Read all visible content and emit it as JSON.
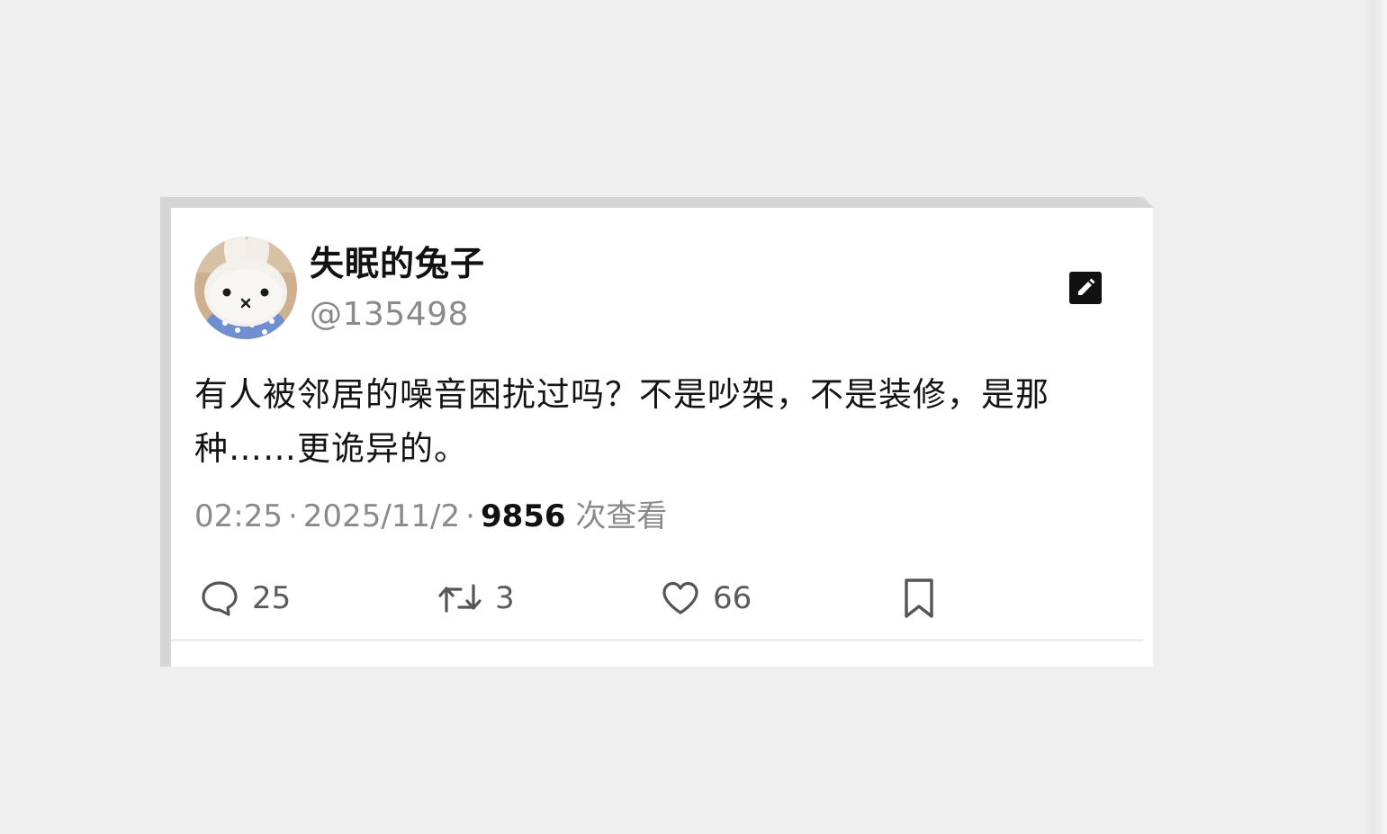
{
  "post": {
    "author": {
      "display_name": "失眠的兔子",
      "handle": "@135498"
    },
    "text": "有人被邻居的噪音困扰过吗？不是吵架，不是装修，是那种……更诡异的。",
    "time": "02:25",
    "date": "2025/11/2",
    "views_count": "9856",
    "views_label": "次查看",
    "separator": "·",
    "actions": {
      "replies": "25",
      "retweets": "3",
      "likes": "66"
    }
  },
  "icons": {
    "edit": "edit-pencil-icon",
    "reply": "speech-bubble-icon",
    "retweet": "retweet-arrows-icon",
    "like": "heart-icon",
    "bookmark": "bookmark-icon"
  },
  "colors": {
    "background": "#efefef",
    "card": "#ffffff",
    "text_primary": "#111111",
    "text_secondary": "#8a8a8a",
    "icon": "#555555"
  }
}
